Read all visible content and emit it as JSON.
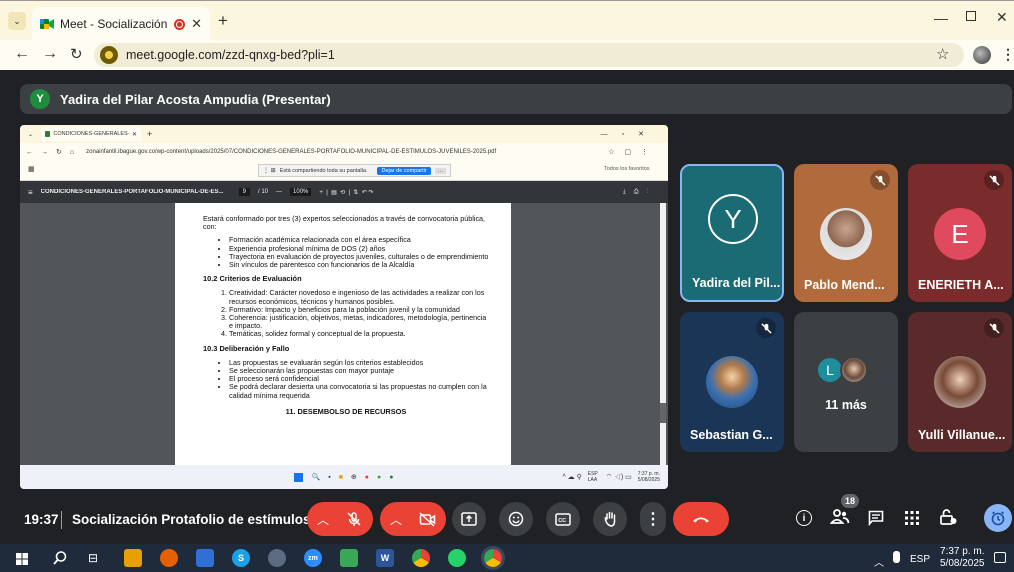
{
  "browser": {
    "tab_title": "Meet - Socialización Protafo",
    "url": "meet.google.com/zzd-qnxg-bed?pli=1"
  },
  "meet": {
    "presenter_initial": "Y",
    "presenter_label": "Yadira del Pilar Acosta Ampudia (Presentar)",
    "time": "19:37",
    "meeting_title": "Socialización Protafolio de estímulos ...",
    "participant_count": "18",
    "tiles": [
      {
        "name": "Yadira del Pil...",
        "initial": "Y",
        "avatar_color": "#1a6b73",
        "muted": false,
        "active": true
      },
      {
        "name": "Pablo Mend...",
        "initial": "",
        "muted": true
      },
      {
        "name": "ENERIETH A...",
        "initial": "E",
        "avatar_color": "#e04a5f",
        "muted": true
      },
      {
        "name": "Sebastian G...",
        "initial": "",
        "muted": true
      },
      {
        "name": "11 más",
        "initial": "L",
        "avatar_color": "#1e8e9c",
        "muted": false
      },
      {
        "name": "Yulli Villanue...",
        "initial": "",
        "muted": true
      }
    ]
  },
  "shared_screen": {
    "tab_title": "CONDICIONES-GENERALES-PO",
    "url": "zonainfantil.ibague.gov.co/wp-content/uploads/2025/07/CONDICIONES-GENERALES-PORTAFOLIO-MUNICIPAL-DE-ESTIMULOS-JUVENILES-2025.pdf",
    "sharing_notice": "Está compartiendo toda su pantalla.",
    "stop_sharing": "Dejar de compartir",
    "bookmarks": "Todos los favoritos",
    "pdf_title": "CONDICIONES-GENERALES-PORTAFOLIO-MUNICIPAL-DE-ES...",
    "page_current": "9",
    "page_total": "/ 10",
    "zoom": "100%",
    "page": {
      "intro": "Estará conformado por tres (3) expertos seleccionados a través de convocatoria pública, con:",
      "list1": [
        "Formación académica relacionada con el área específica",
        "Experiencia profesional mínima de DOS (2) años",
        "Trayectoria en evaluación de proyectos juveniles, culturales o de emprendimiento",
        "Sin vínculos de parentesco con funcionarios de la Alcaldía"
      ],
      "h1": "10.2 Criterios de Evaluación",
      "list2": [
        "Creatividad: Carácter novedoso e ingenioso de las actividades a realizar con los recursos económicos, técnicos y humanos posibles.",
        "Formativo: Impacto y beneficios para la población juvenil y la comunidad",
        "Coherencia: justificación, objetivos, metas, indicadores, metodología, pertinencia e impacto.",
        "Temáticas, solidez formal y conceptual de la propuesta."
      ],
      "h2": "10.3 Deliberación y Fallo",
      "list3": [
        "Las propuestas se evaluarán según los criterios establecidos",
        "Se seleccionarán las propuestas con mayor puntaje",
        "El proceso será confidencial",
        "Se podrá declarar desierta una convocatoria si las propuestas no cumplen con la calidad mínima requerida"
      ],
      "h3": "11. DESEMBOLSO DE RECURSOS"
    },
    "taskbar_lang": "ESP LAA",
    "taskbar_time": "7:37 p. m.",
    "taskbar_date": "5/08/2025"
  },
  "windows": {
    "lang": "ESP",
    "time": "7:37 p. m.",
    "date": "5/08/2025"
  }
}
